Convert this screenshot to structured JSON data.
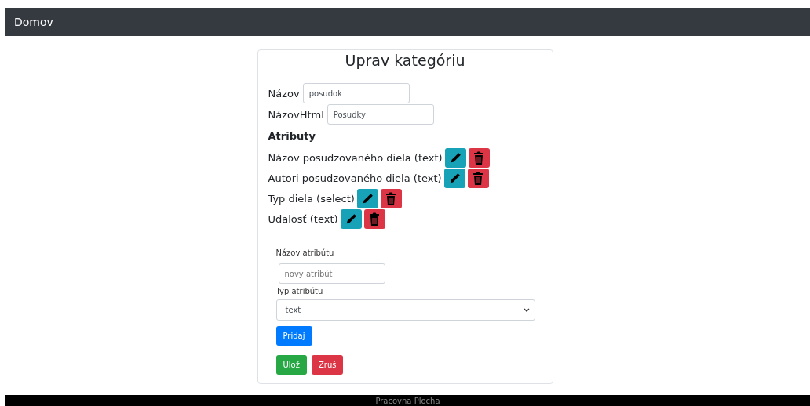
{
  "navbar": {
    "brand": "Domov"
  },
  "form": {
    "title": "Uprav kategóriu",
    "fields": [
      {
        "label": "Názov",
        "value": "posudok"
      },
      {
        "label": "NázovHtml",
        "value": "Posudky"
      }
    ],
    "attributes_heading": "Atributy",
    "attributes": [
      {
        "label": "Názov posudzovaného diela (text)"
      },
      {
        "label": "Autori posudzovaného diela (text)"
      },
      {
        "label": "Typ diela (select)"
      },
      {
        "label": "Udalosť (text)"
      }
    ],
    "new_attribute": {
      "name_label": "Názov atribútu",
      "name_placeholder": "novy atribút",
      "type_label": "Typ atribútu",
      "type_value": "text",
      "add_button": "Pridaj"
    },
    "buttons": [
      {
        "label": "Ulož",
        "kind": "success"
      },
      {
        "label": "Zruš",
        "kind": "danger"
      }
    ]
  },
  "footer": {
    "text": "Pracovna Plocha"
  }
}
